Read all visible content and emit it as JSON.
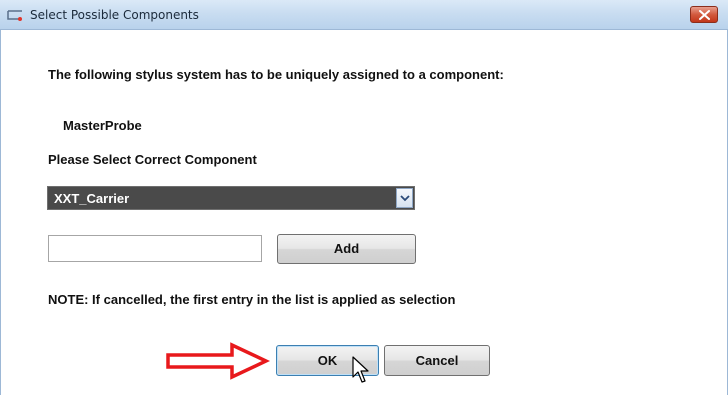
{
  "window": {
    "title": "Select Possible Components",
    "close_icon": "close-icon"
  },
  "dialog": {
    "message": "The following stylus system has to be uniquely assigned to a component:",
    "stylus_name": "MasterProbe",
    "select_prompt": "Please Select Correct Component",
    "component_select": {
      "selected_value": "XXT_Carrier"
    },
    "new_component_input": {
      "value": "",
      "placeholder": ""
    },
    "add_label": "Add",
    "note": "NOTE: If cancelled, the first entry in the list is applied as selection",
    "ok_label": "OK",
    "cancel_label": "Cancel"
  },
  "colors": {
    "select_background": "#4a4a4a",
    "annotation_arrow": "#e8191c",
    "close_button": "#c2371b"
  }
}
